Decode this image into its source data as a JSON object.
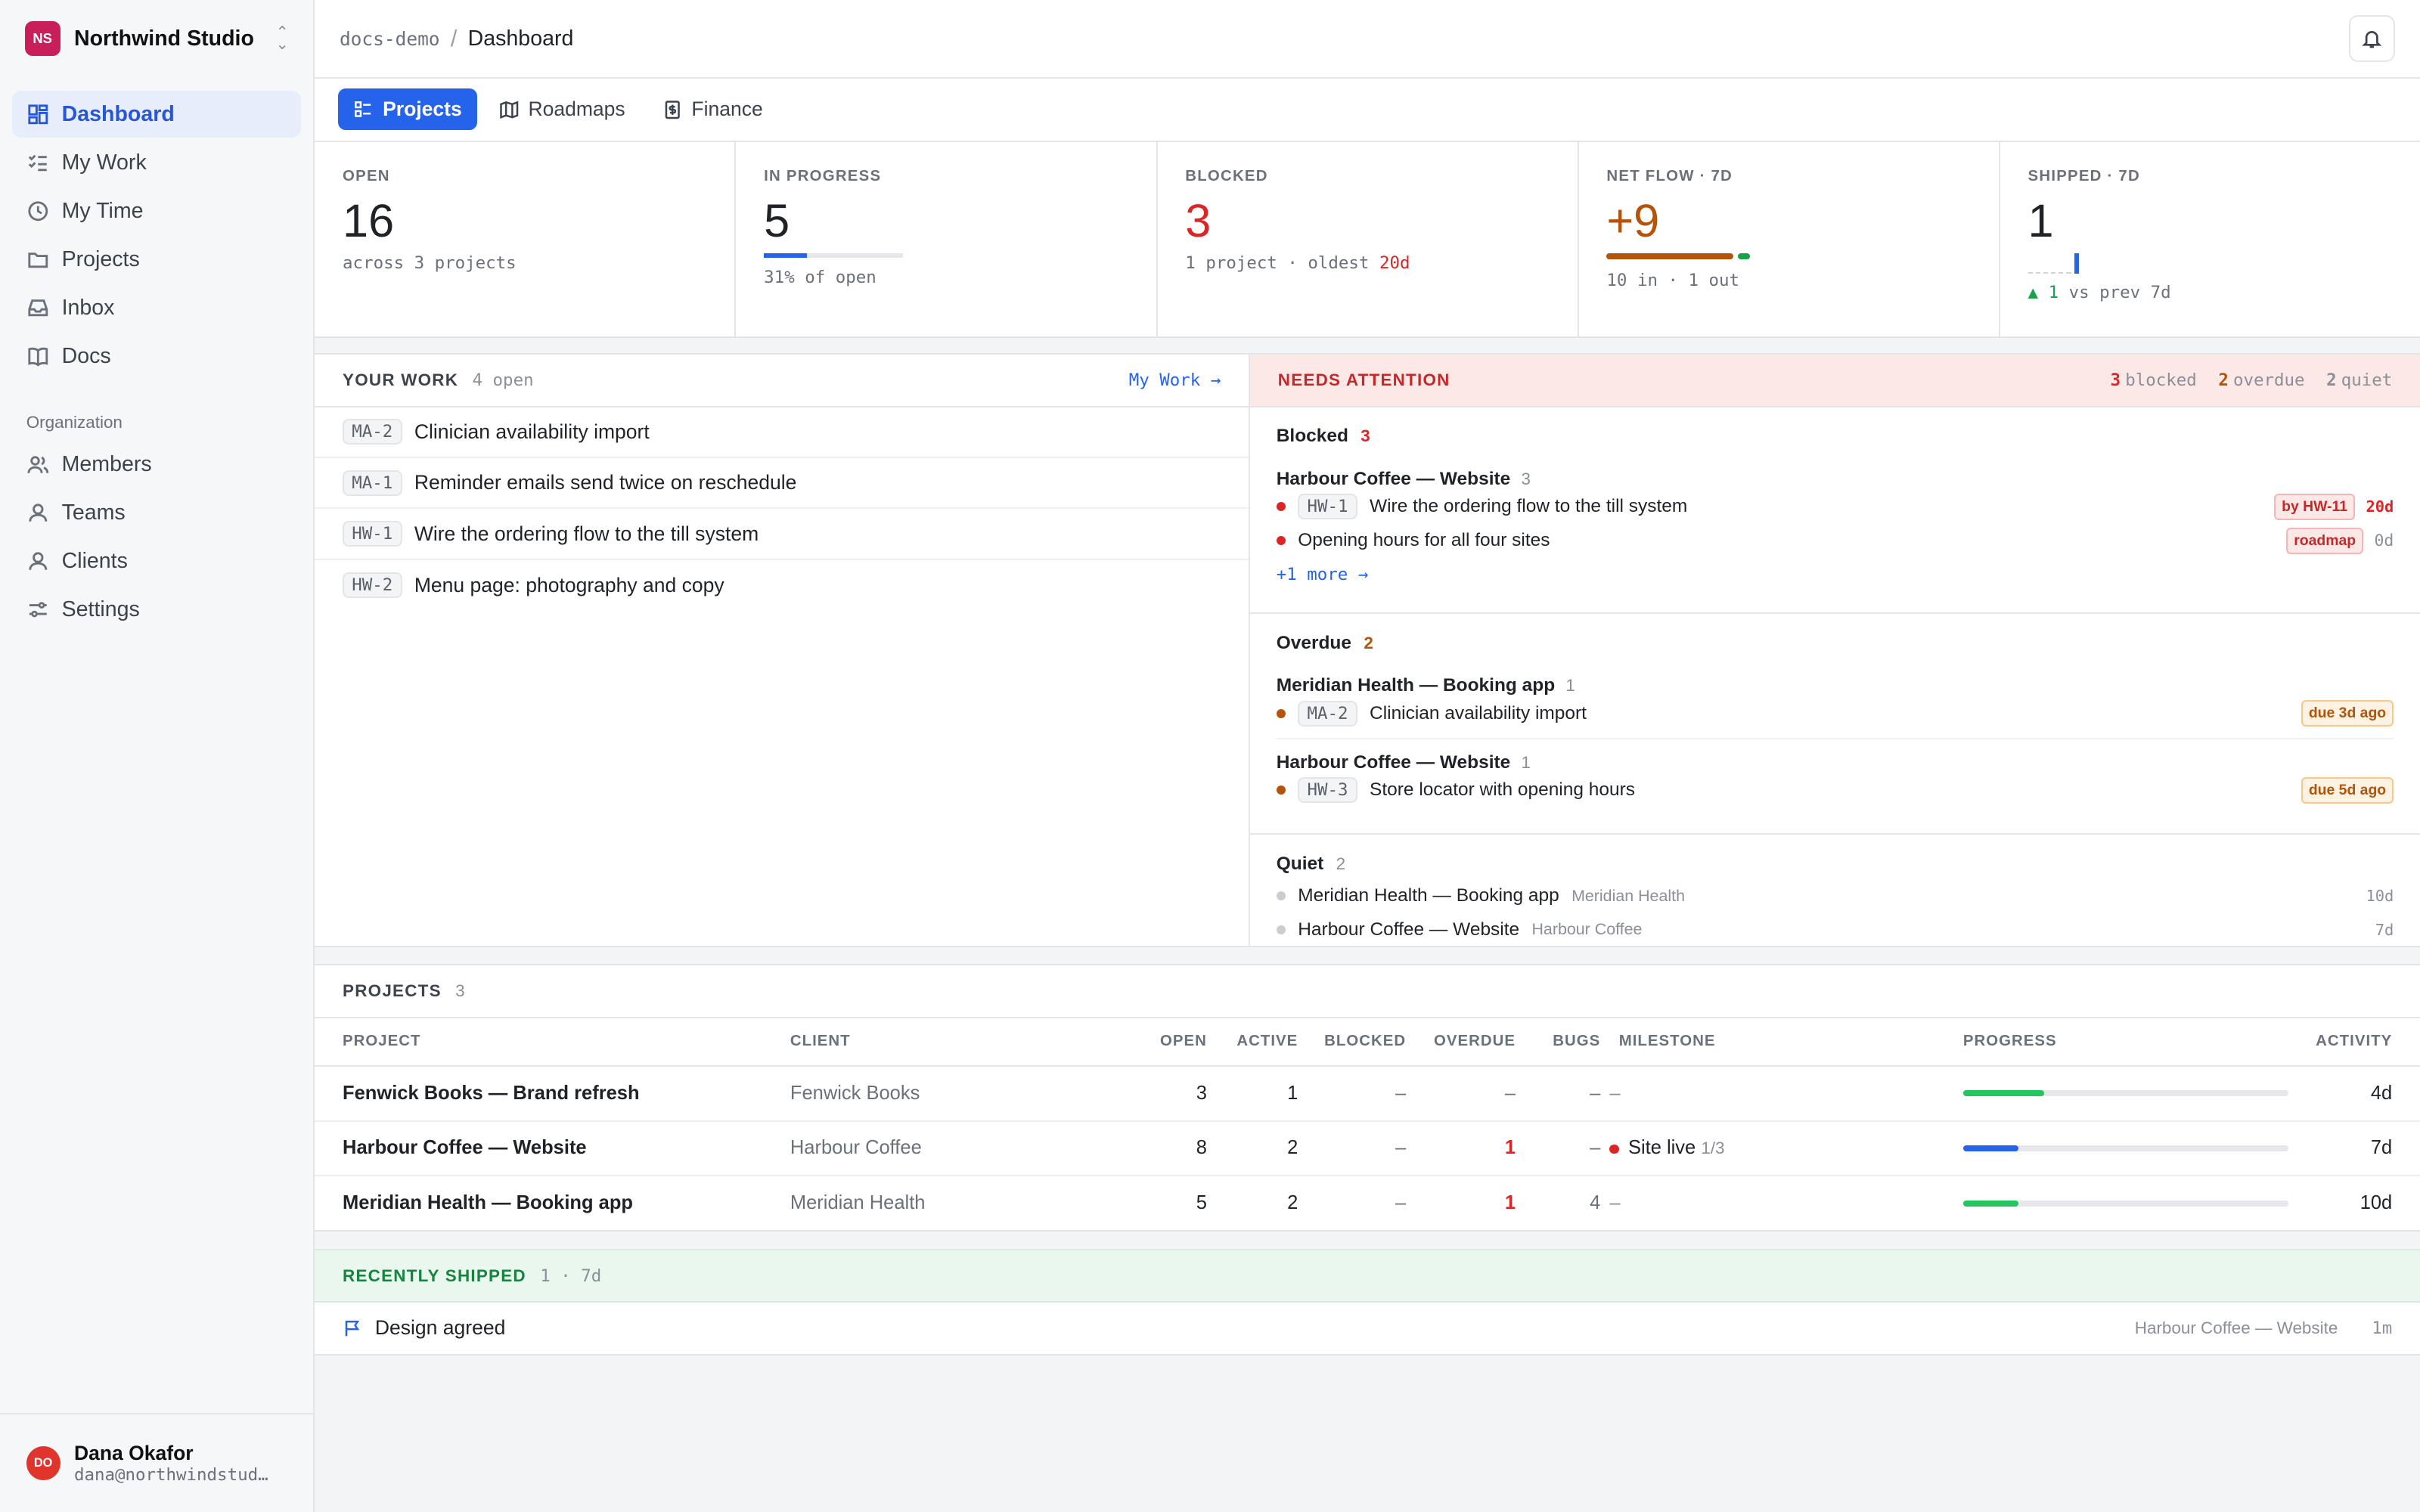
{
  "workspace": {
    "initials": "NS",
    "name": "Northwind Studio"
  },
  "nav": {
    "items": [
      {
        "label": "Dashboard"
      },
      {
        "label": "My Work"
      },
      {
        "label": "My Time"
      },
      {
        "label": "Projects"
      },
      {
        "label": "Inbox"
      },
      {
        "label": "Docs"
      }
    ],
    "org_section": "Organization",
    "org_items": [
      {
        "label": "Members"
      },
      {
        "label": "Teams"
      },
      {
        "label": "Clients"
      },
      {
        "label": "Settings"
      }
    ]
  },
  "user": {
    "initials": "DO",
    "name": "Dana Okafor",
    "email": "dana@northwindstud…"
  },
  "breadcrumb": {
    "workspace": "docs-demo",
    "separator": "/",
    "page": "Dashboard"
  },
  "tabs": [
    {
      "label": "Projects"
    },
    {
      "label": "Roadmaps"
    },
    {
      "label": "Finance"
    }
  ],
  "kpis": {
    "open": {
      "label": "OPEN",
      "value": "16",
      "sub": "across 3 projects"
    },
    "in_progress": {
      "label": "IN PROGRESS",
      "value": "5",
      "sub": "31% of open",
      "progress": 0.31
    },
    "blocked": {
      "label": "BLOCKED",
      "value": "3",
      "sub": "1 project · oldest ",
      "sub_highlight": "20d"
    },
    "net_flow": {
      "label": "NET FLOW · 7D",
      "value": "+9",
      "sub": "10 in · 1 out",
      "in": 10,
      "out": 1
    },
    "shipped": {
      "label": "SHIPPED · 7D",
      "value": "1",
      "delta": "▲ 1",
      "delta_suffix": " vs prev 7d"
    }
  },
  "your_work": {
    "title": "YOUR WORK",
    "count": "4 open",
    "link": "My Work →",
    "items": [
      {
        "key": "MA-2",
        "title": "Clinician availability import"
      },
      {
        "key": "MA-1",
        "title": "Reminder emails send twice on reschedule"
      },
      {
        "key": "HW-1",
        "title": "Wire the ordering flow to the till system"
      },
      {
        "key": "HW-2",
        "title": "Menu page: photography and copy"
      }
    ]
  },
  "attention": {
    "title": "NEEDS ATTENTION",
    "stats": {
      "blocked_n": "3",
      "blocked_label": "blocked",
      "overdue_n": "2",
      "overdue_label": "overdue",
      "quiet_n": "2",
      "quiet_label": "quiet"
    },
    "blocked": {
      "label": "Blocked",
      "count": "3",
      "project": "Harbour Coffee — Website",
      "project_count": "3",
      "items": [
        {
          "key": "HW-1",
          "title": "Wire the ordering flow to the till system",
          "badge": "by HW-11",
          "age": "20d"
        },
        {
          "title": "Opening hours for all four sites",
          "badge": "roadmap",
          "age": "0d"
        }
      ],
      "more": "+1 more →"
    },
    "overdue": {
      "label": "Overdue",
      "count": "2",
      "groups": [
        {
          "project": "Meridian Health — Booking app",
          "count": "1",
          "key": "MA-2",
          "title": "Clinician availability import",
          "badge": "due 3d ago"
        },
        {
          "project": "Harbour Coffee — Website",
          "count": "1",
          "key": "HW-3",
          "title": "Store locator with opening hours",
          "badge": "due 5d ago"
        }
      ]
    },
    "quiet": {
      "label": "Quiet",
      "count": "2",
      "items": [
        {
          "title": "Meridian Health — Booking app",
          "client": "Meridian Health",
          "age": "10d"
        },
        {
          "title": "Harbour Coffee — Website",
          "client": "Harbour Coffee",
          "age": "7d"
        }
      ]
    }
  },
  "projects": {
    "title": "PROJECTS",
    "count": "3",
    "columns": [
      "PROJECT",
      "CLIENT",
      "OPEN",
      "ACTIVE",
      "BLOCKED",
      "OVERDUE",
      "BUGS",
      "MILESTONE",
      "PROGRESS",
      "ACTIVITY"
    ],
    "rows": [
      {
        "project": "Fenwick Books — Brand refresh",
        "client": "Fenwick Books",
        "open": "3",
        "active": "1",
        "blocked": "–",
        "overdue": "–",
        "bugs": "–",
        "milestone": "–",
        "milestone_count": "",
        "progress": 0.25,
        "activity": "4d"
      },
      {
        "project": "Harbour Coffee — Website",
        "client": "Harbour Coffee",
        "open": "8",
        "active": "2",
        "blocked": "–",
        "overdue": "1",
        "bugs": "–",
        "milestone": "Site live",
        "milestone_count": "1/3",
        "progress": 0.17,
        "activity": "7d"
      },
      {
        "project": "Meridian Health — Booking app",
        "client": "Meridian Health",
        "open": "5",
        "active": "2",
        "blocked": "–",
        "overdue": "1",
        "bugs": "4",
        "milestone": "–",
        "milestone_count": "",
        "progress": 0.17,
        "activity": "10d"
      }
    ]
  },
  "shipped": {
    "title": "RECENTLY SHIPPED",
    "count": "1 · 7d",
    "items": [
      {
        "title": "Design agreed",
        "project": "Harbour Coffee — Website",
        "age": "1m"
      }
    ]
  },
  "colors": {
    "accent": "#2563eb",
    "red": "#dc2626",
    "amber": "#b45309",
    "green": "#16a34a"
  },
  "icons": [
    "dashboard-icon",
    "checklist-icon",
    "clock-icon",
    "folder-icon",
    "inbox-icon",
    "book-icon",
    "users-icon",
    "user-icon",
    "sliders-icon",
    "bell-icon",
    "map-icon",
    "dollar-icon",
    "flag-icon"
  ]
}
